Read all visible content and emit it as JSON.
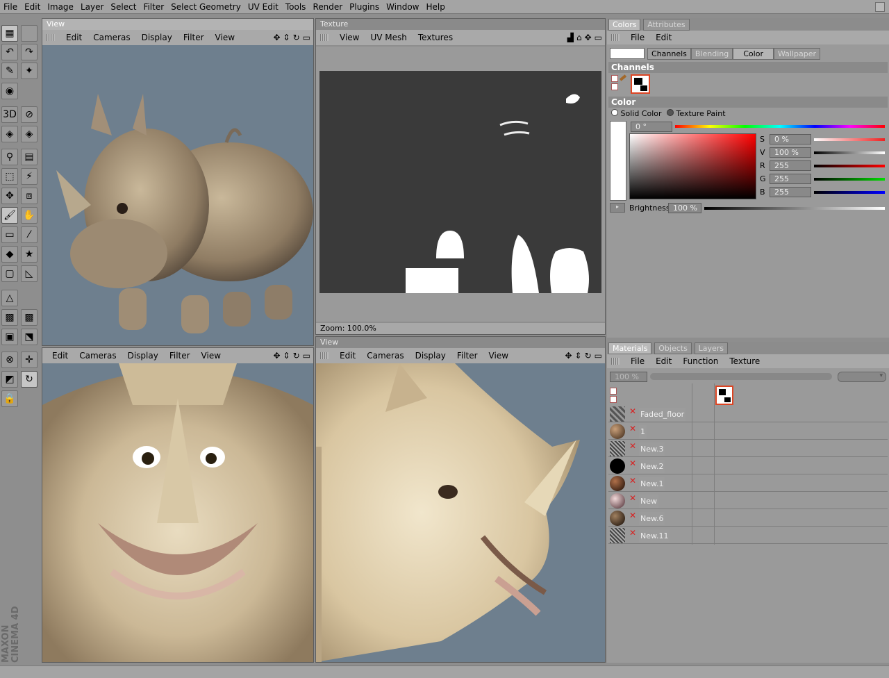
{
  "menubar": {
    "items": [
      "File",
      "Edit",
      "Image",
      "Layer",
      "Select",
      "Filter",
      "Select Geometry",
      "UV Edit",
      "Tools",
      "Render",
      "Plugins",
      "Window",
      "Help"
    ]
  },
  "viewport_tl": {
    "title": "View",
    "menu": [
      "Edit",
      "Cameras",
      "Display",
      "Filter",
      "View"
    ]
  },
  "viewport_bl": {
    "menu": [
      "Edit",
      "Cameras",
      "Display",
      "Filter",
      "View"
    ]
  },
  "viewport_br": {
    "title": "View",
    "menu": [
      "Edit",
      "Cameras",
      "Display",
      "Filter",
      "View"
    ]
  },
  "texture": {
    "title": "Texture",
    "menu": [
      "View",
      "UV Mesh",
      "Textures"
    ],
    "zoom": "Zoom: 100.0%"
  },
  "colors_panel": {
    "tabs": [
      "Colors",
      "Attributes"
    ],
    "menu": [
      "File",
      "Edit"
    ],
    "subtabs": [
      "Channels",
      "Blending",
      "Color",
      "Wallpaper"
    ],
    "channels_label": "Channels",
    "color_label": "Color",
    "mode_solid": "Solid Color",
    "mode_texture": "Texture Paint",
    "hue": "0 °",
    "s_label": "S",
    "s_value": "0 %",
    "v_label": "V",
    "v_value": "100 %",
    "r_label": "R",
    "r_value": "255",
    "g_label": "G",
    "g_value": "255",
    "b_label": "B",
    "b_value": "255",
    "brightness_label": "Brightness",
    "brightness_value": "100 %"
  },
  "materials_panel": {
    "tabs": [
      "Materials",
      "Objects",
      "Layers"
    ],
    "menu": [
      "File",
      "Edit",
      "Function",
      "Texture"
    ],
    "zoom_field": "100 %",
    "materials": [
      {
        "name": "Faded_floor"
      },
      {
        "name": "1"
      },
      {
        "name": "New.3"
      },
      {
        "name": "New.2"
      },
      {
        "name": "New.1"
      },
      {
        "name": "New"
      },
      {
        "name": "New.6"
      },
      {
        "name": "New.11"
      }
    ]
  },
  "brand": {
    "line1": "MAXON",
    "line2": "CINEMA 4D"
  },
  "colors": {
    "ui_gray": "#a4a4a4",
    "viewport_bg": "#6e7f8e",
    "texture_bg": "#3a3a3a",
    "accent_red": "#d72222"
  }
}
